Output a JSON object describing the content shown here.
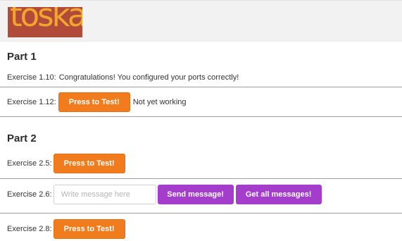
{
  "header": {
    "logo_text": "toska"
  },
  "part1": {
    "title": "Part 1",
    "ex110": {
      "label": "Exercise 1.10:",
      "message": "Congratulations! You configured your ports correctly!"
    },
    "ex112": {
      "label": "Exercise 1.12:",
      "button": "Press to Test!",
      "status": "Not yet working"
    }
  },
  "part2": {
    "title": "Part 2",
    "ex25": {
      "label": "Exercise 2.5:",
      "button": "Press to Test!"
    },
    "ex26": {
      "label": "Exercise 2.6:",
      "input_placeholder": "Write message here",
      "input_value": "",
      "send_button": "Send message!",
      "get_button": "Get all messages!"
    },
    "ex28": {
      "label": "Exercise 2.8:",
      "button": "Press to Test!"
    }
  },
  "colors": {
    "orange_button": "#f07c1d",
    "purple_button": "#a43ccc",
    "logo_red": "#b24a3a",
    "logo_orange": "#f0a62e"
  }
}
